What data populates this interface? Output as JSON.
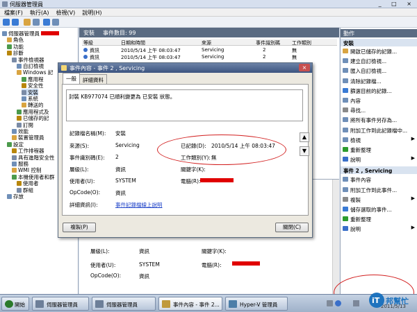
{
  "window": {
    "title": "伺服器管理員",
    "controls": "_ □ ×"
  },
  "menu": [
    "檔案(F)",
    "執行(A)",
    "檢視(V)",
    "說明(H)"
  ],
  "tree": {
    "items": [
      {
        "label": "伺服器管理員",
        "indent": 0
      },
      {
        "label": "角色",
        "indent": 1
      },
      {
        "label": "功能",
        "indent": 1
      },
      {
        "label": "診斷",
        "indent": 1
      },
      {
        "label": "事件檢視器",
        "indent": 2
      },
      {
        "label": "自訂檢視",
        "indent": 3
      },
      {
        "label": "Windows 記",
        "indent": 3
      },
      {
        "label": "應用程",
        "indent": 4
      },
      {
        "label": "安全性",
        "indent": 4
      },
      {
        "label": "安裝",
        "indent": 4
      },
      {
        "label": "系統",
        "indent": 4
      },
      {
        "label": "轉送的",
        "indent": 4
      },
      {
        "label": "應用程式及",
        "indent": 3
      },
      {
        "label": "已儲存的記",
        "indent": 3
      },
      {
        "label": "訂閱",
        "indent": 3
      },
      {
        "label": "效能",
        "indent": 2
      },
      {
        "label": "裝置管理員",
        "indent": 2
      },
      {
        "label": "設定",
        "indent": 1
      },
      {
        "label": "工作排程器",
        "indent": 2
      },
      {
        "label": "具有進階安全性",
        "indent": 2
      },
      {
        "label": "服務",
        "indent": 2
      },
      {
        "label": "WMI 控制",
        "indent": 2
      },
      {
        "label": "本機使用者和群",
        "indent": 2
      },
      {
        "label": "使用者",
        "indent": 3
      },
      {
        "label": "群組",
        "indent": 3
      },
      {
        "label": "存放",
        "indent": 1
      }
    ]
  },
  "center": {
    "title": "安裝",
    "event_count": "事件數目: 99",
    "columns": [
      "等級",
      "日期和時間",
      "來源",
      "事件識別碼",
      "工作類別"
    ],
    "rows": [
      [
        "資訊",
        "2010/5/14 上午 08:03:47",
        "Servicing",
        "2",
        "無"
      ],
      [
        "資訊",
        "2010/5/14 上午 08:03:47",
        "Servicing",
        "2",
        "無"
      ]
    ],
    "lower": {
      "level_label": "層級(L):",
      "level_value": "資訊",
      "keywords_label": "關鍵字(K):",
      "user_label": "使用者(U):",
      "user_value": "SYSTEM",
      "computer_label": "電腦(R):",
      "opcode_label": "OpCode(O):",
      "opcode_value": "資訊"
    }
  },
  "dialog": {
    "title": "事件內容 - 事件 2 , Servicing",
    "tabs": [
      "一般",
      "詳細資料"
    ],
    "description": "封裝 KB977074 已順利變更為 已安裝 狀態。",
    "log_name_label": "記錄檔名稱(M):",
    "log_name_value": "安裝",
    "source_label": "來源(S):",
    "source_value": "Servicing",
    "logged_label": "已記錄(D):",
    "logged_value": "2010/5/14 上午 08:03:47",
    "event_id_label": "事件識別碼(E):",
    "event_id_value": "2",
    "task_category_label": "工作類別(Y):",
    "task_category_value": "無",
    "level_label": "層級(L):",
    "level_value": "資訊",
    "keywords_label": "關鍵字(K):",
    "user_label": "使用者(U):",
    "user_value": "SYSTEM",
    "computer_label": "電腦(R):",
    "opcode_label": "OpCode(O):",
    "opcode_value": "資訊",
    "more_info_label": "詳細資訊(I):",
    "more_info_link": "事件記錄檔線上說明",
    "copy_button": "複製(P)",
    "close_button": "關閉(C)"
  },
  "actions": {
    "header": "動作",
    "section1": "安裝",
    "section1_items": [
      {
        "label": "開啟已儲存的記錄...",
        "arrow": ""
      },
      {
        "label": "建立自訂檢視...",
        "arrow": ""
      },
      {
        "label": "匯入自訂檢視...",
        "arrow": ""
      },
      {
        "label": "清除記錄檔...",
        "arrow": ""
      },
      {
        "label": "篩選目前的記錄...",
        "arrow": ""
      },
      {
        "label": "內容",
        "arrow": ""
      },
      {
        "label": "尋找...",
        "arrow": ""
      },
      {
        "label": "將所有事件另存為...",
        "arrow": ""
      },
      {
        "label": "附加工作到此記錄檔中...",
        "arrow": ""
      },
      {
        "label": "檢視",
        "arrow": "▶"
      },
      {
        "label": "重新整理",
        "arrow": ""
      },
      {
        "label": "說明",
        "arrow": "▶"
      }
    ],
    "section2": "事件 2 , Servicing",
    "section2_items": [
      {
        "label": "事件內容",
        "arrow": ""
      },
      {
        "label": "附加工作到此事件...",
        "arrow": ""
      },
      {
        "label": "複製",
        "arrow": "▶"
      },
      {
        "label": "儲存選取的事件...",
        "arrow": ""
      },
      {
        "label": "重新整理",
        "arrow": ""
      },
      {
        "label": "說明",
        "arrow": "▶"
      }
    ]
  },
  "taskbar": {
    "start": "開始",
    "tasks": [
      "伺服器管理員",
      "伺服器管理員",
      "事件內容 - 事件 2...",
      "Hyper-V 管理員"
    ],
    "clock": "2011/5/13",
    "logo_text": "iT邦幫忙"
  },
  "colors": {
    "highlight_ellipse": "#d21f1f",
    "redaction": "#e00000",
    "pane_header": "#5a6b82"
  }
}
